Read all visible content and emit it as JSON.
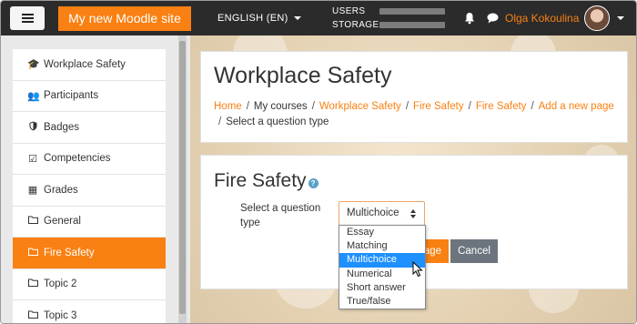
{
  "navbar": {
    "site_name": "My new Moodle site",
    "language": "ENGLISH (EN)",
    "quota": [
      {
        "label": "USERS"
      },
      {
        "label": "STORAGE"
      }
    ],
    "user_name": "Olga Kokoulina"
  },
  "sidebar": {
    "items": [
      {
        "label": "Workplace Safety",
        "icon": "graduation-cap-icon"
      },
      {
        "label": "Participants",
        "icon": "users-icon"
      },
      {
        "label": "Badges",
        "icon": "shield-icon"
      },
      {
        "label": "Competencies",
        "icon": "check-square-icon"
      },
      {
        "label": "Grades",
        "icon": "table-icon"
      },
      {
        "label": "General",
        "icon": "folder-icon"
      },
      {
        "label": "Fire Safety",
        "icon": "folder-icon",
        "active": true
      },
      {
        "label": "Topic 2",
        "icon": "folder-icon"
      },
      {
        "label": "Topic 3",
        "icon": "folder-icon"
      }
    ]
  },
  "header": {
    "title": "Workplace Safety",
    "breadcrumb": [
      "Home",
      "My courses",
      "Workplace Safety",
      "Fire Safety",
      "Fire Safety",
      "Add a new page",
      "Select a question type"
    ]
  },
  "main": {
    "section_title": "Fire Safety",
    "field_label": "Select a question type",
    "select_value": "Multichoice",
    "options": [
      "Essay",
      "Matching",
      "Multichoice",
      "Numerical",
      "Short answer",
      "True/false"
    ],
    "selected_option": "Multichoice",
    "submit_label_visible": "age",
    "cancel_label": "Cancel"
  },
  "colors": {
    "accent": "#f98012",
    "navbar": "#2b2b2b",
    "selection": "#1e90ff",
    "cancel": "#6c757d"
  }
}
